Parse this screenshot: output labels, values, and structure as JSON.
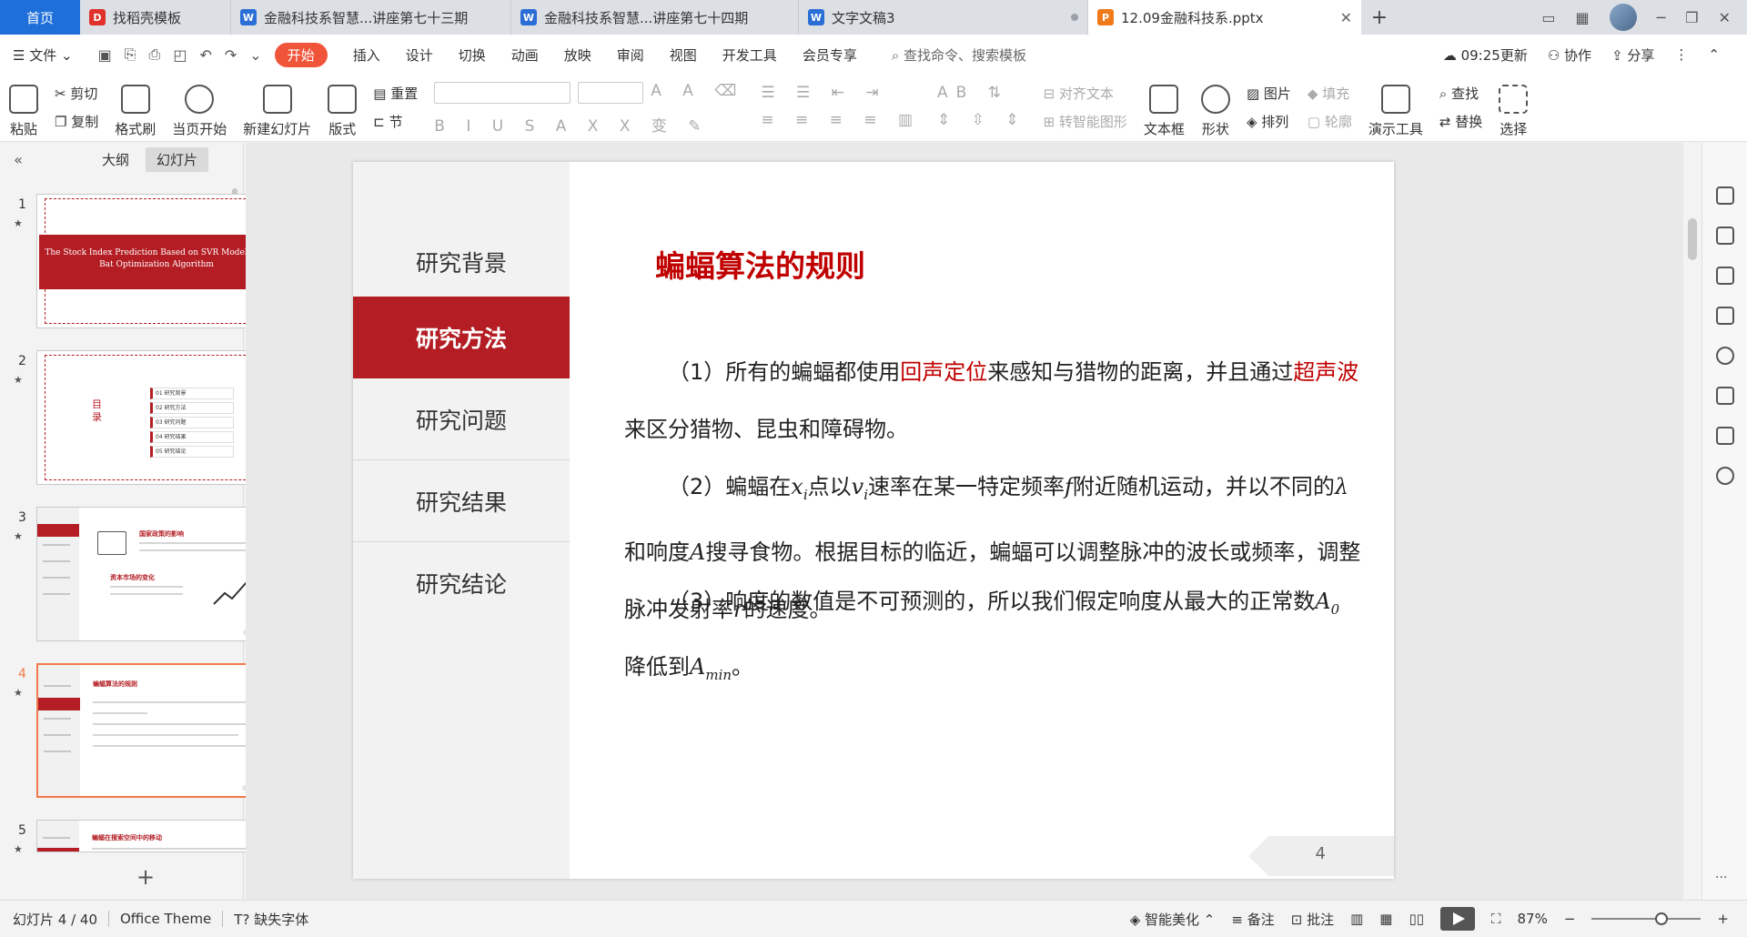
{
  "tabs": {
    "home": "首页",
    "items": [
      {
        "label": "找稻壳模板",
        "icon": "docer-icon",
        "color": "#e0312a",
        "glyph": "D",
        "width": 224
      },
      {
        "label": "金融科技系智慧...讲座第七十三期",
        "icon": "wps-writer-icon",
        "color": "#2b6fd6",
        "glyph": "W",
        "width": 314
      },
      {
        "label": "金融科技系智慧...讲座第七十四期",
        "icon": "wps-writer-icon",
        "color": "#2b6fd6",
        "glyph": "W",
        "width": 318
      },
      {
        "label": "文字文稿3",
        "icon": "wps-writer-icon",
        "color": "#2b6fd6",
        "glyph": "W",
        "width": 320
      }
    ],
    "active": {
      "label": "12.09金融科技系.pptx",
      "icon": "wps-presentation-icon",
      "color": "#f07a1a",
      "glyph": "P"
    }
  },
  "menu": {
    "file": "文件",
    "items": [
      "插入",
      "设计",
      "切换",
      "动画",
      "放映",
      "审阅",
      "视图",
      "开发工具",
      "会员专享"
    ],
    "start": "开始",
    "search": "查找命令、搜索模板",
    "sync_time": "09:25更新",
    "collaborate": "协作",
    "share": "分享"
  },
  "ribbon": {
    "paste": "粘贴",
    "cut": "剪切",
    "copy": "复制",
    "format_painter": "格式刷",
    "play_from_current": "当页开始",
    "new_slide": "新建幻灯片",
    "layout": "版式",
    "reset": "重置",
    "section": "节",
    "align_text": "对齐文本",
    "convert_smartart": "转智能图形",
    "textbox": "文本框",
    "shape": "形状",
    "picture": "图片",
    "fill": "填充",
    "arrange": "排列",
    "outline": "轮廓",
    "presenter_tools": "演示工具",
    "find": "查找",
    "replace": "替换",
    "select": "选择"
  },
  "left_pane": {
    "tab_outline": "大纲",
    "tab_slides": "幻灯片",
    "thumb1_title": "The Stock Index Prediction Based on SVR Model with Bat Optimization Algorithm",
    "thumb2_mulu": "目录",
    "thumb2_items": [
      "01 研究背景",
      "02 研究方法",
      "03 研究问题",
      "04 研究结果",
      "05 研究结论"
    ],
    "thumb3_title": "国家政策的影响",
    "thumb3_sub": "资本市场的变化",
    "thumb4_title": "蝙蝠算法的规则",
    "thumb5_title": "蝙蝠在搜索空间中的移动",
    "numbers": [
      "1",
      "2",
      "3",
      "4",
      "5"
    ]
  },
  "slide": {
    "nav": [
      "研究背景",
      "研究方法",
      "研究问题",
      "研究结果",
      "研究结论"
    ],
    "active_nav_index": 1,
    "title": "蝙蝠算法的规则",
    "p1": {
      "a": "（1）所有的蝙蝠都使用",
      "r1": "回声定位",
      "b": "来感知与猎物的距离，并且通过",
      "r2": "超声波",
      "c": "来区分猎物、昆虫和障碍物。"
    },
    "p2": {
      "a": "（2）蝙蝠在",
      "b": "点以",
      "c": "速率在某一特定频率",
      "d": "附近随机运动，并以不同的",
      "e": "和响度",
      "f": "搜寻食物。根据目标的临近，蝙蝠可以调整脉冲的波长或频率，调整脉冲发射率",
      "g": "的速度。"
    },
    "p3": {
      "a": "（3）响度的数值是不可预测的，所以我们假定响度从最大的正常数",
      "b": "降低到",
      "c": "。"
    },
    "page_number": "4",
    "accent_color": "#b31d23"
  },
  "status": {
    "slide_info": "幻灯片 4 / 40",
    "theme": "Office Theme",
    "missing_font": "缺失字体",
    "beautify": "智能美化",
    "notes": "备注",
    "comments": "批注",
    "zoom": "87%"
  }
}
